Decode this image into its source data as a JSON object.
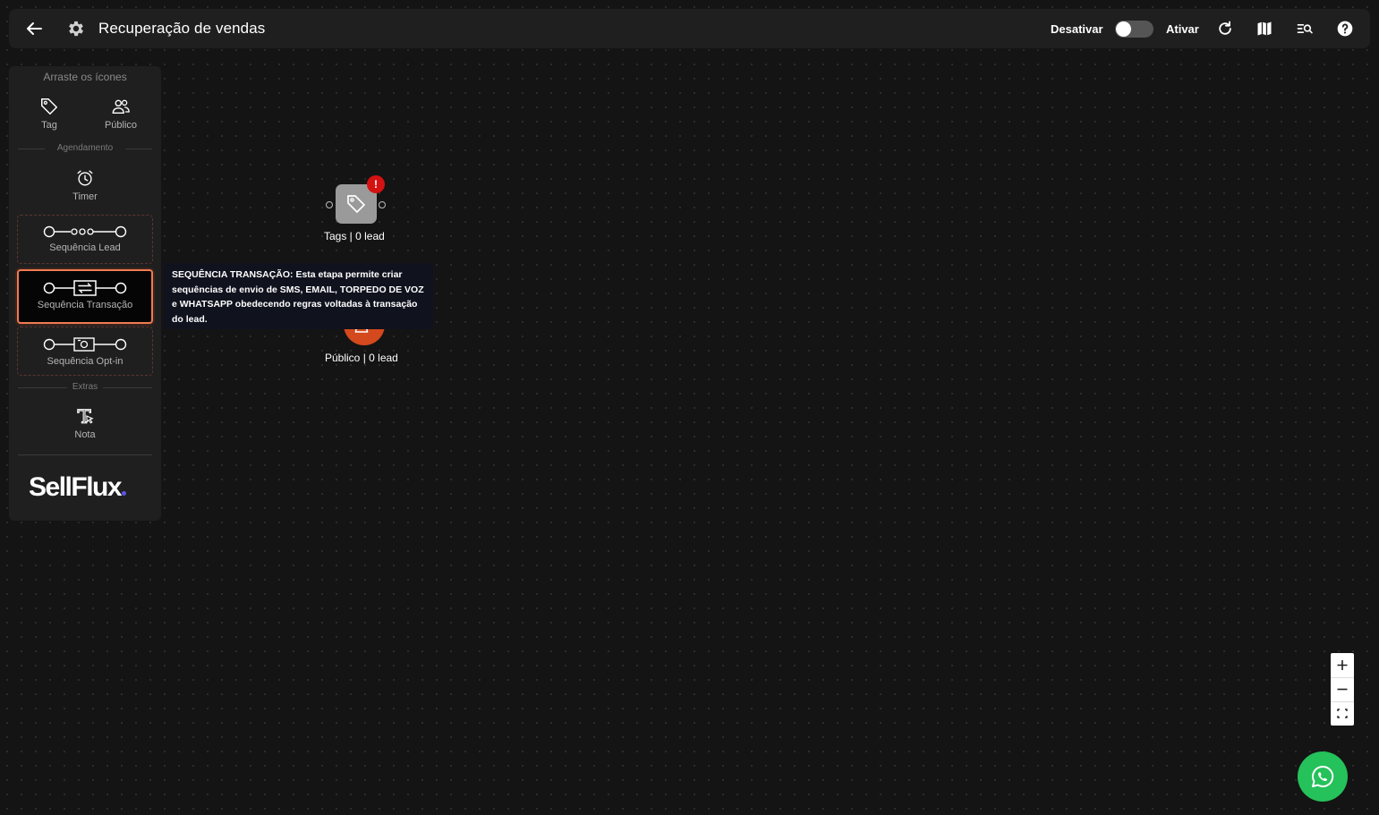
{
  "header": {
    "title": "Recuperação de vendas",
    "deactivate_label": "Desativar",
    "activate_label": "Ativar"
  },
  "sidebar": {
    "hint": "Arraste os ícones",
    "items": {
      "tag": "Tag",
      "publico": "Público",
      "timer": "Timer",
      "nota": "Nota"
    },
    "sections": {
      "agendamento": "Agendamento",
      "extras": "Extras"
    },
    "sequences": {
      "lead": "Sequência Lead",
      "transacao": "Sequência Transação",
      "optin": "Sequência Opt-in"
    },
    "logo": "SellFlux"
  },
  "canvas": {
    "nodes": [
      {
        "label": "Tags | 0 lead",
        "badge": "!"
      },
      {
        "label": "Público | 0 lead"
      }
    ],
    "tooltip": "SEQUÊNCIA TRANSAÇÃO: Esta etapa permite criar sequências de envio de SMS, EMAIL, TORPEDO DE VOZ e WHATSAPP obedecendo regras voltadas à transação do lead."
  },
  "zoom": {
    "in": "+",
    "out": "−"
  },
  "colors": {
    "accent": "#f07b51",
    "public_node": "#d4491d",
    "whatsapp": "#25c15a",
    "badge": "#d41212"
  }
}
